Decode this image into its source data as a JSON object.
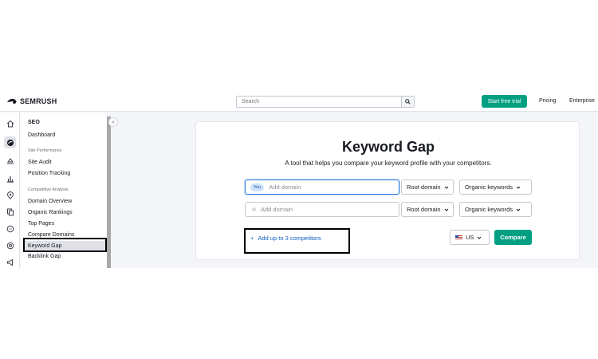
{
  "header": {
    "brand": "SEMRUSH",
    "search_placeholder": "Search",
    "trial_label": "Start free trial",
    "nav": [
      "Pricing",
      "Enterprise"
    ]
  },
  "rail": {
    "icons": [
      "home-icon",
      "seo-icon",
      "traffic-icon",
      "chart-icon",
      "location-icon",
      "content-icon",
      "social-icon",
      "ads-icon",
      "pr-icon"
    ]
  },
  "sidebar": {
    "section": "SEO",
    "dashboard": "Dashboard",
    "groups": [
      {
        "title": "Site Performance",
        "items": [
          "Site Audit",
          "Position Tracking"
        ]
      },
      {
        "title": "Competitive Analysis",
        "items": [
          "Domain Overview",
          "Organic Rankings",
          "Top Pages",
          "Compare Domains",
          "Keyword Gap",
          "Backlink Gap"
        ]
      }
    ],
    "selected": "Keyword Gap"
  },
  "main": {
    "title": "Keyword Gap",
    "subtitle": "A tool that helps you compare your keyword profile with your competitors.",
    "you_badge": "You",
    "domain_placeholder": "Add domain",
    "scope": "Root domain",
    "keyword_type": "Organic keywords",
    "add_competitors": "Add up to 3 competitors",
    "country": "US",
    "compare": "Compare"
  },
  "colors": {
    "accent_green": "#009f81",
    "link_blue": "#0a5fbe",
    "focus_blue": "#2b7bd7"
  }
}
